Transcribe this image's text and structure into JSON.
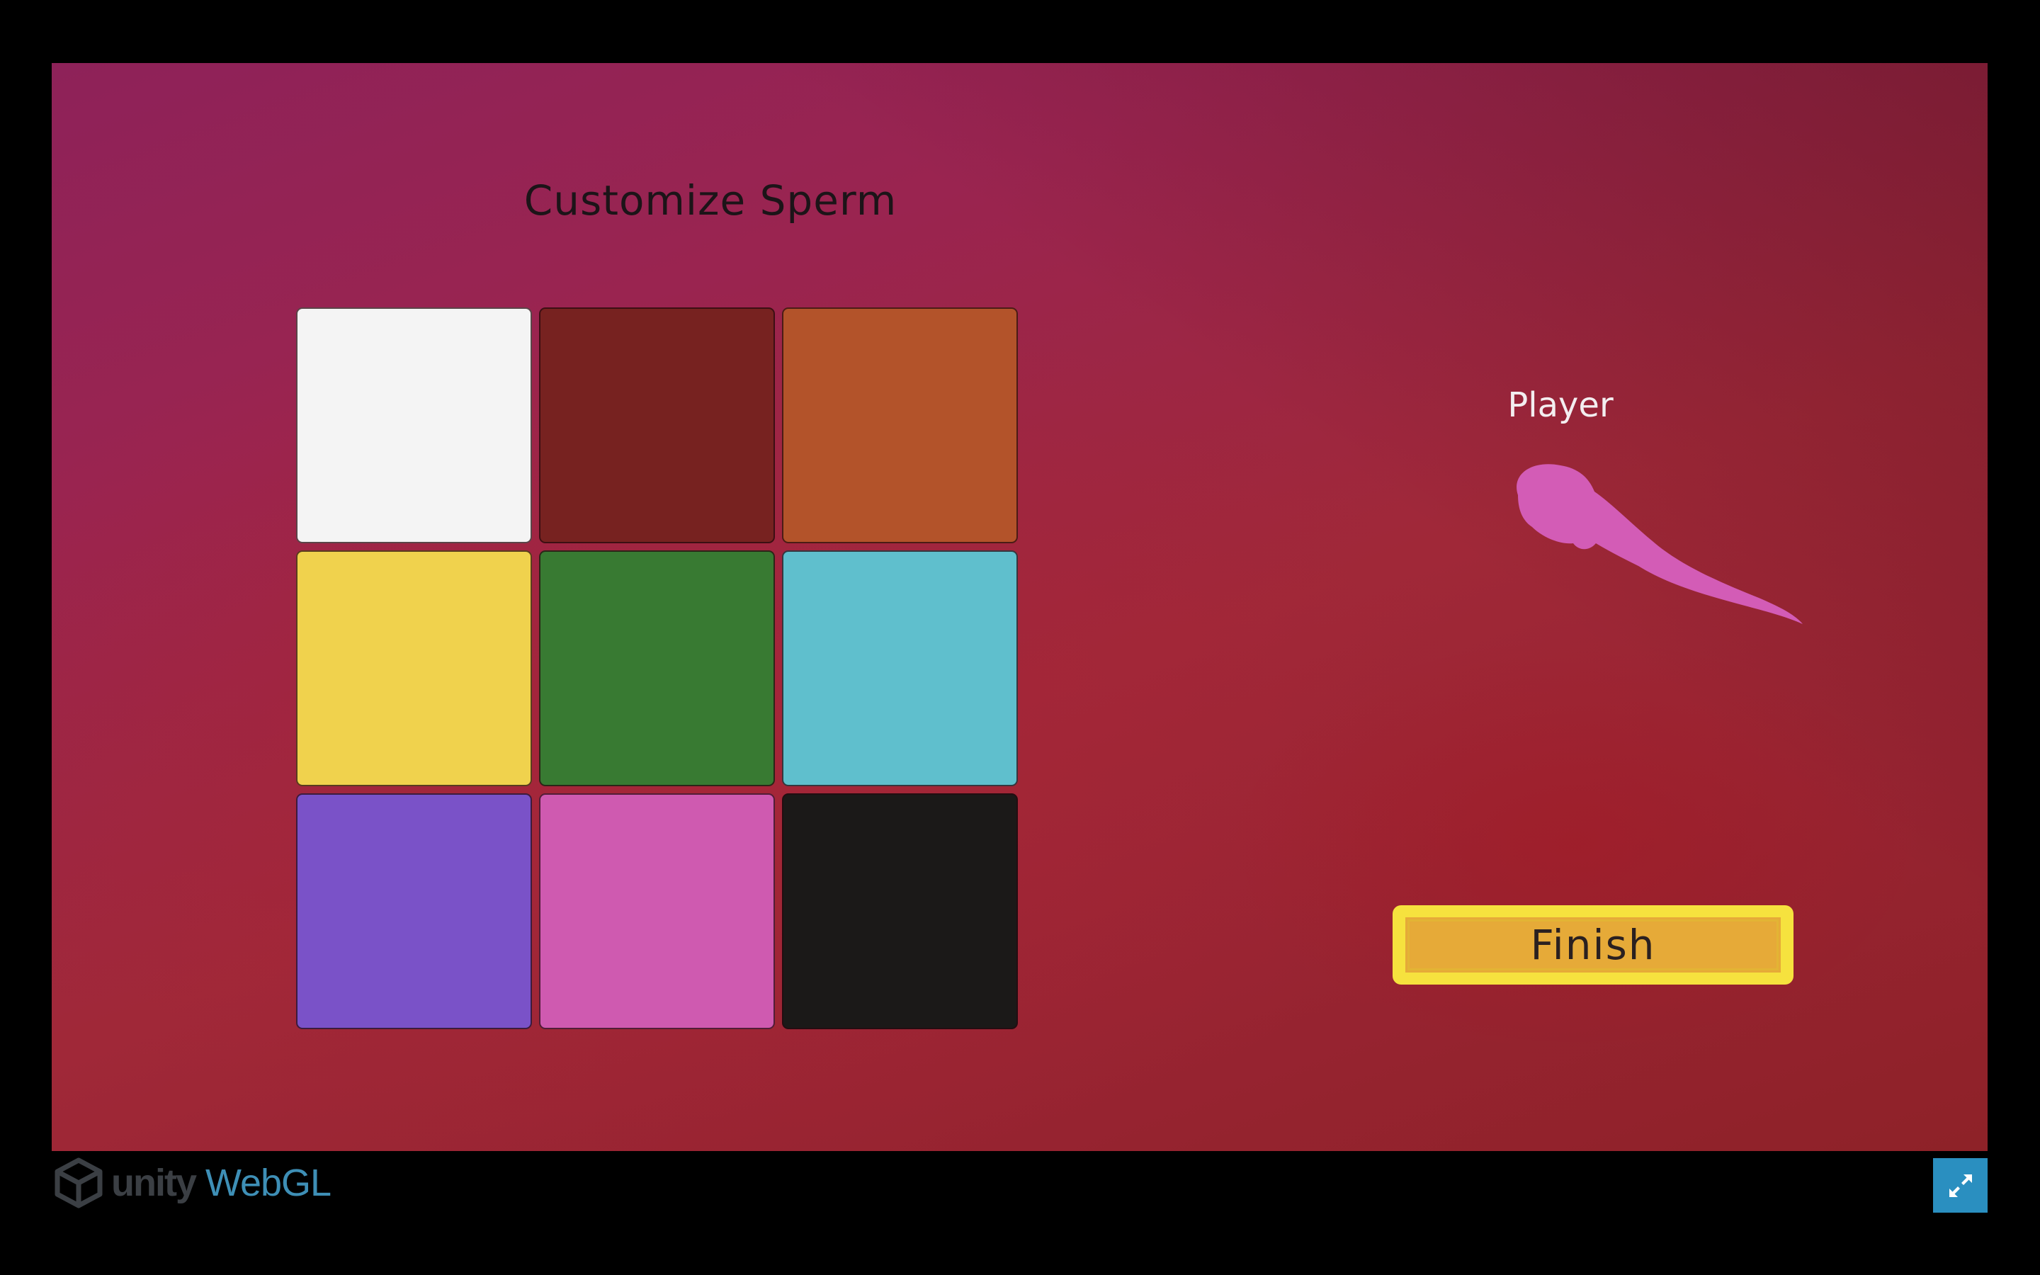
{
  "screen": {
    "title": "Customize Sperm",
    "player_label": "Player",
    "finish_label": "Finish"
  },
  "swatches": [
    {
      "name": "white",
      "color": "#f4f4f4"
    },
    {
      "name": "dark-red",
      "color": "#772220"
    },
    {
      "name": "orange",
      "color": "#b3532a"
    },
    {
      "name": "yellow",
      "color": "#f0d24d"
    },
    {
      "name": "green",
      "color": "#387a32"
    },
    {
      "name": "cyan",
      "color": "#5fbfcd"
    },
    {
      "name": "purple",
      "color": "#7a52c8"
    },
    {
      "name": "pink",
      "color": "#cf5ab0"
    },
    {
      "name": "black",
      "color": "#1b1918"
    }
  ],
  "player": {
    "selected_color": "#d35cb6"
  },
  "footer": {
    "unity_text": "unity",
    "webgl_text": "WebGL",
    "fullscreen_icon": "fullscreen-icon"
  }
}
